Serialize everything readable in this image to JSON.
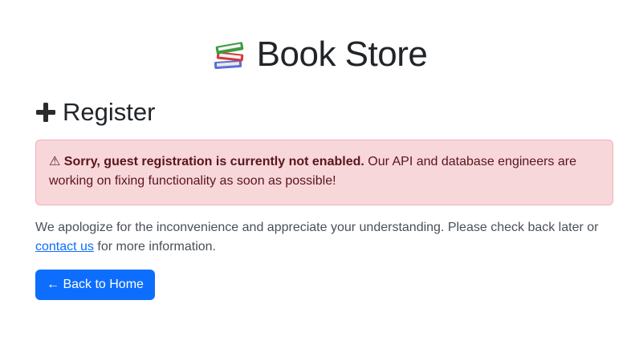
{
  "header": {
    "icon": "books-icon",
    "title": "Book Store"
  },
  "page": {
    "heading_icon": "plus-icon",
    "heading": "Register"
  },
  "alert": {
    "icon_glyph": "⚠",
    "bold_text": "Sorry, guest registration is currently not enabled.",
    "body_text": "Our API and database engineers are working on fixing functionality as soon as possible!",
    "colors": {
      "background": "#f8d7da",
      "border": "#f1aeb5",
      "text": "#58151c"
    }
  },
  "info": {
    "text_before": "We apologize for the inconvenience and appreciate your understanding. Please check back later or ",
    "link_label": "contact us",
    "text_after": " for more information."
  },
  "actions": {
    "back_label": "← Back to Home",
    "color": "#0d6efd"
  }
}
